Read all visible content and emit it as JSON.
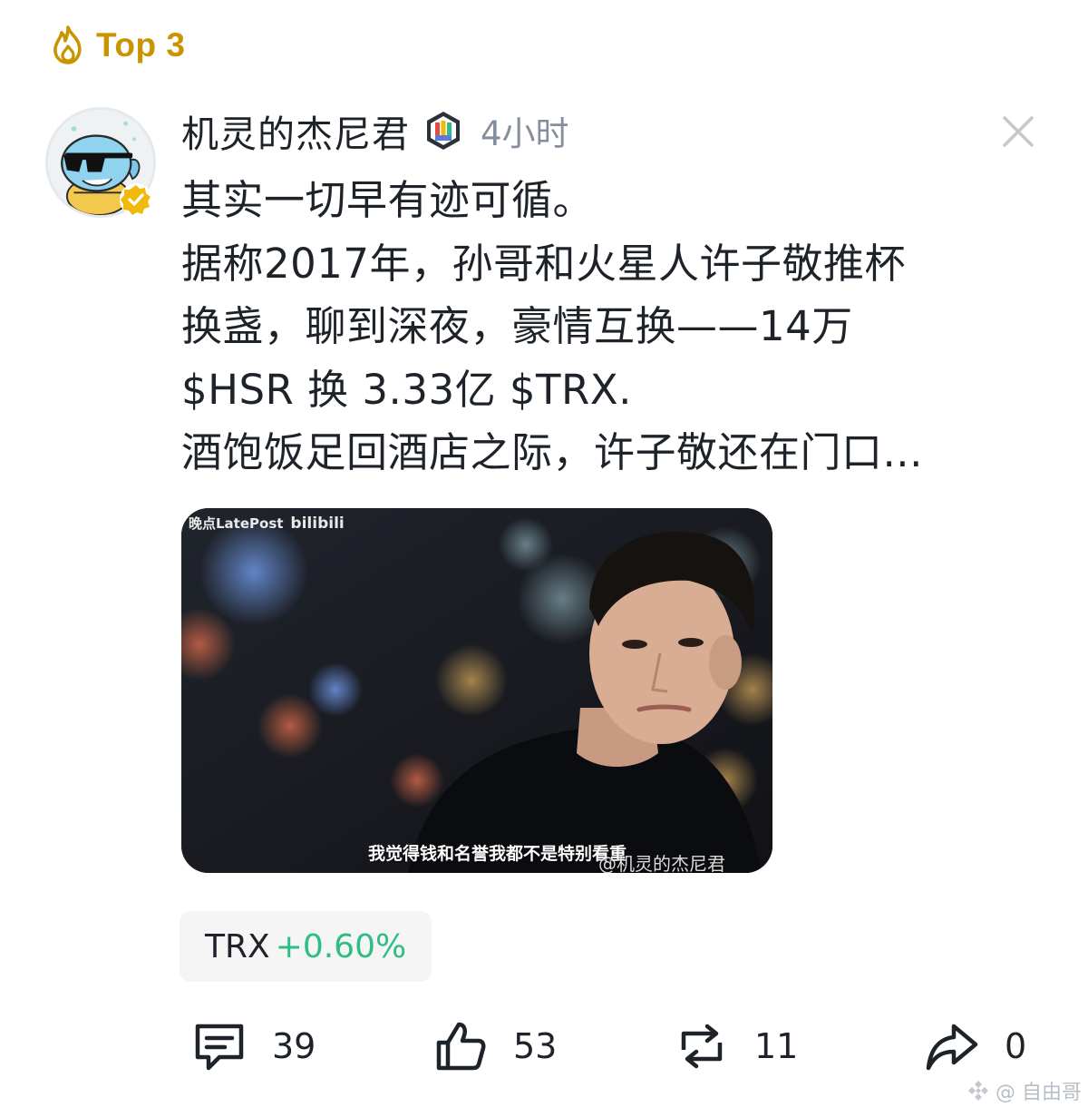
{
  "badge": {
    "label": "Top 3",
    "icon": "flame-icon",
    "color": "#c99400"
  },
  "post": {
    "author": "机灵的杰尼君",
    "creator_badge_icon": "creator-badge-icon",
    "time": "4小时",
    "text_lines": [
      "其实一切早有迹可循。",
      "据称2017年，孙哥和火星人许子敬推杯",
      "换盏，聊到深夜，豪情互换——14万",
      "$HSR 换 3.33亿 $TRX.",
      "酒饱饭足回酒店之际，许子敬还在门口..."
    ],
    "media": {
      "watermark_top": "晚点LatePost",
      "watermark_brand": "bilibili",
      "subtitle": "我觉得钱和名誉我都不是特别看重",
      "watermark_author": "@机灵的杰尼君"
    }
  },
  "coin_tag": {
    "symbol": "TRX",
    "change": "+0.60%",
    "change_color": "#2ebd85"
  },
  "actions": {
    "comments": {
      "count": "39",
      "icon": "comment-icon"
    },
    "likes": {
      "count": "53",
      "icon": "thumbs-up-icon"
    },
    "reposts": {
      "count": "11",
      "icon": "repost-icon"
    },
    "shares": {
      "count": "0",
      "icon": "share-icon"
    }
  },
  "footer_watermark": "@ 自由哥"
}
